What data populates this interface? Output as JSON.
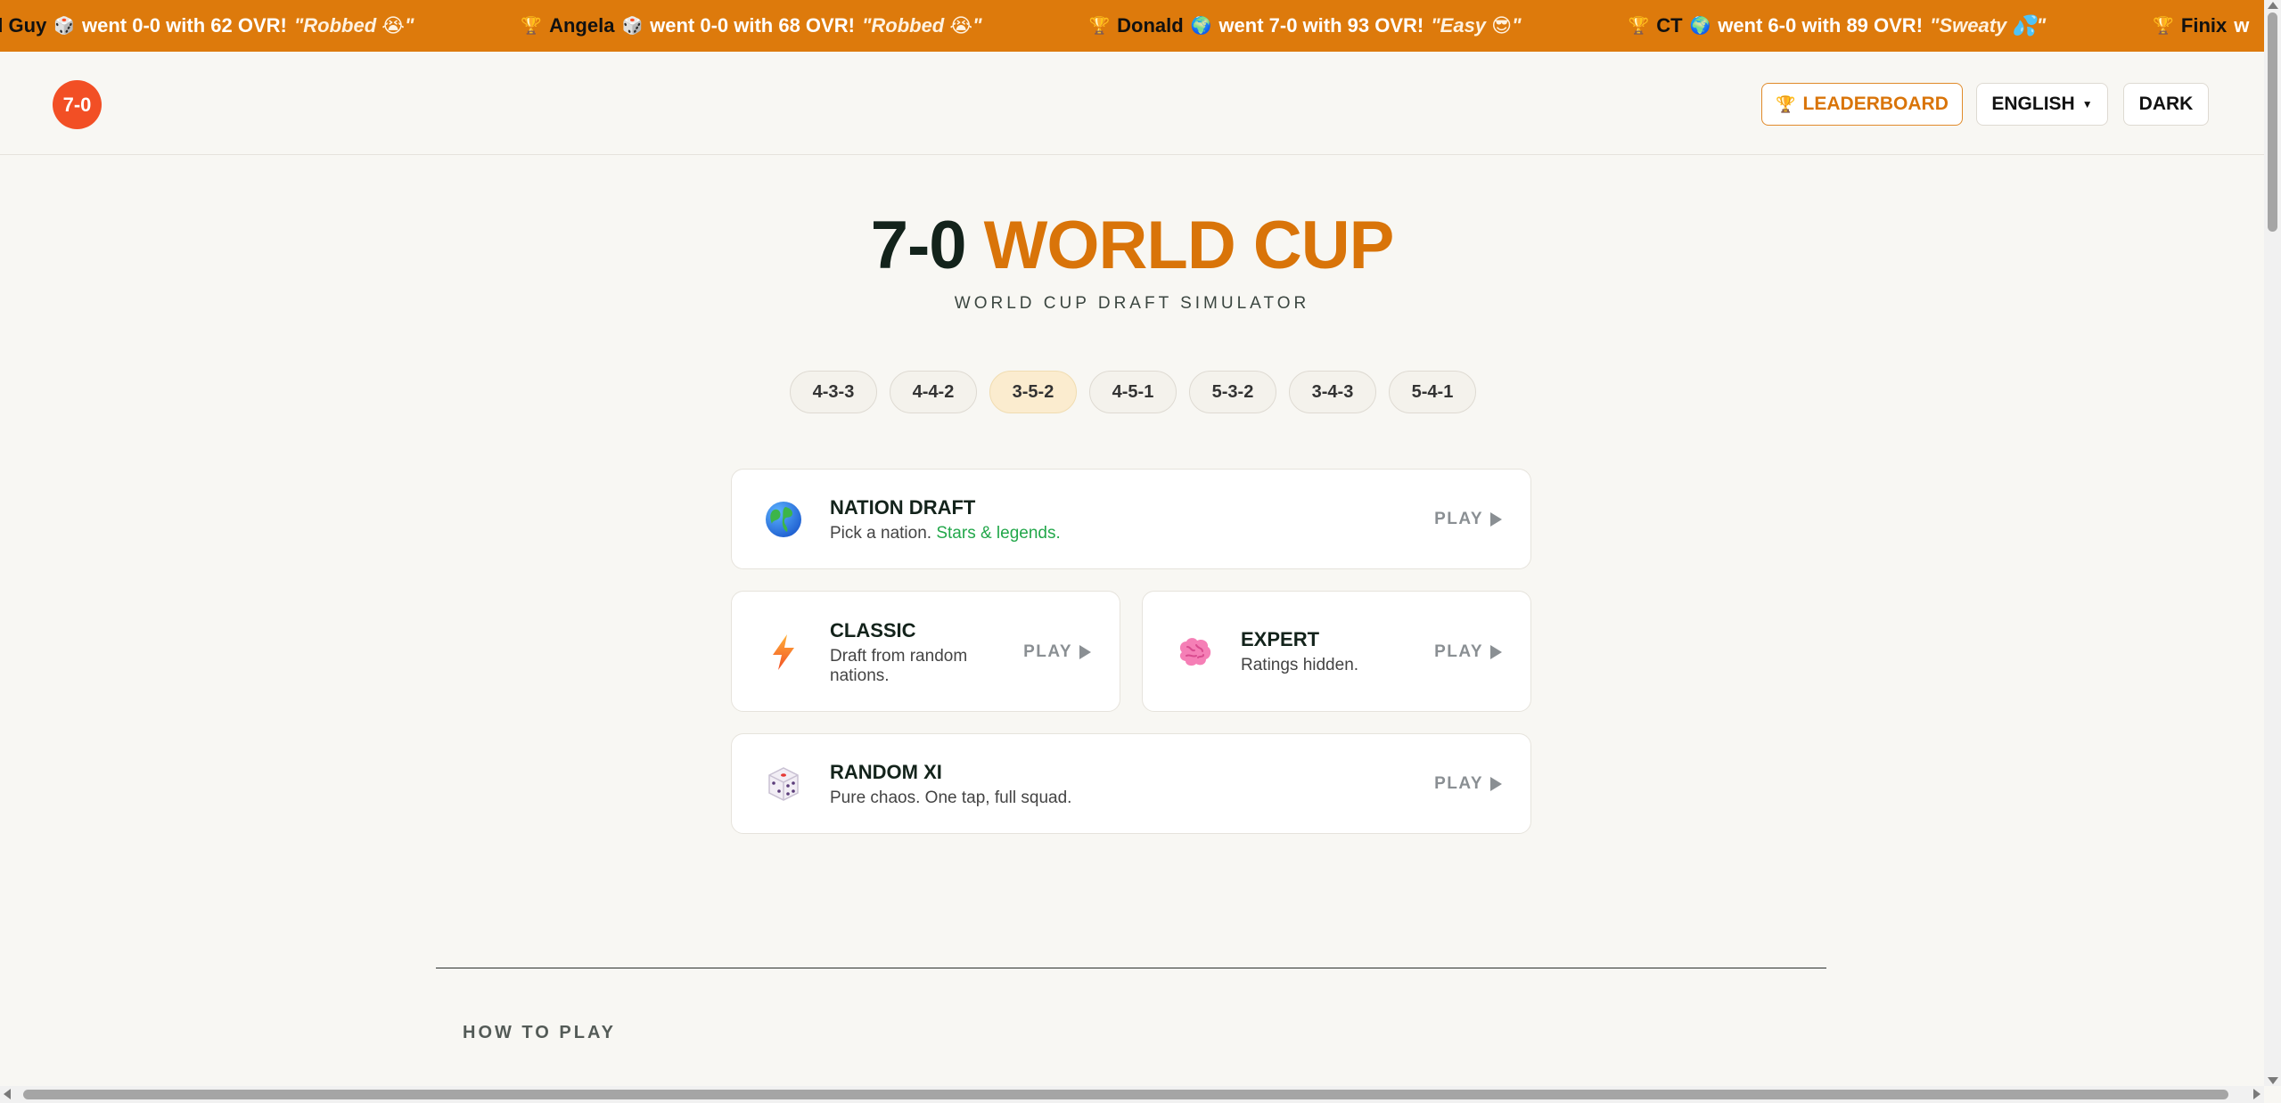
{
  "ticker": [
    {
      "name": "d Guy",
      "emoji": "🎲",
      "text": "went 0-0 with 62 OVR!",
      "quote": "\"Robbed 😭\"",
      "trophy": ""
    },
    {
      "name": "Angela",
      "emoji": "🎲",
      "text": "went 0-0 with 68 OVR!",
      "quote": "\"Robbed 😭\"",
      "trophy": "🏆"
    },
    {
      "name": "Donald",
      "emoji": "🌍",
      "text": "went 7-0 with 93 OVR!",
      "quote": "\"Easy 😎\"",
      "trophy": "🏆"
    },
    {
      "name": "CT",
      "emoji": "🌍",
      "text": "went 6-0 with 89 OVR!",
      "quote": "\"Sweaty 💦\"",
      "trophy": "🏆"
    },
    {
      "name": "Finix",
      "emoji": "",
      "text": "w",
      "quote": "",
      "trophy": "🏆"
    }
  ],
  "header": {
    "logo": "7-0",
    "leaderboard_icon": "🏆",
    "leaderboard_label": "LEADERBOARD",
    "language_label": "ENGLISH",
    "dark_label": "DARK"
  },
  "hero": {
    "title_main": "7-0",
    "title_accent": "WORLD CUP",
    "subtitle": "WORLD CUP DRAFT SIMULATOR"
  },
  "formations": {
    "items": [
      "4-3-3",
      "4-4-2",
      "3-5-2",
      "4-5-1",
      "5-3-2",
      "3-4-3",
      "5-4-1"
    ],
    "selected": "3-5-2"
  },
  "modes": {
    "nation": {
      "icon": "globe-icon",
      "title": "NATION DRAFT",
      "desc_plain": "Pick a nation.",
      "desc_green": "Stars & legends.",
      "play": "PLAY"
    },
    "classic": {
      "icon": "lightning-icon",
      "title": "CLASSIC",
      "desc": "Draft from random nations.",
      "play": "PLAY"
    },
    "expert": {
      "icon": "brain-icon",
      "title": "EXPERT",
      "desc": "Ratings hidden.",
      "play": "PLAY"
    },
    "random": {
      "icon": "dice-icon",
      "title": "RANDOM XI",
      "desc": "Pure chaos. One tap, full squad.",
      "play": "PLAY"
    }
  },
  "howto": {
    "heading": "HOW TO PLAY"
  },
  "colors": {
    "ticker": "#dd7a0c",
    "accent": "#d97409",
    "logo": "#f24f25",
    "green": "#22a74a",
    "background": "#f8f7f3"
  }
}
